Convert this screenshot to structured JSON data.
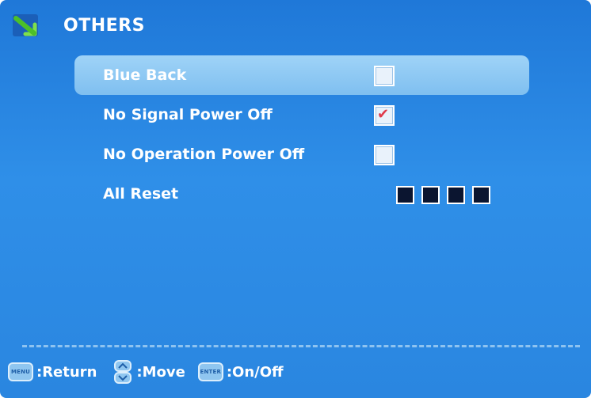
{
  "header": {
    "title": "OTHERS",
    "icon": "green-arrow-icon"
  },
  "menu": {
    "items": [
      {
        "label": "Blue Back",
        "control": "checkbox",
        "checked": false,
        "selected": true
      },
      {
        "label": "No Signal Power Off",
        "control": "checkbox",
        "checked": true,
        "selected": false
      },
      {
        "label": "No Operation Power Off",
        "control": "checkbox",
        "checked": false,
        "selected": false
      },
      {
        "label": "All Reset",
        "control": "pin-boxes",
        "box_count": 4,
        "selected": false
      }
    ]
  },
  "footer": {
    "menu_key": "MENU",
    "return_label": ":Return",
    "move_label": ":Move",
    "enter_key": "ENTER",
    "onoff_label": ":On/Off"
  },
  "colors": {
    "background": "#2a86e0",
    "highlight": "#8ccaf4",
    "check": "#e03a4a"
  }
}
